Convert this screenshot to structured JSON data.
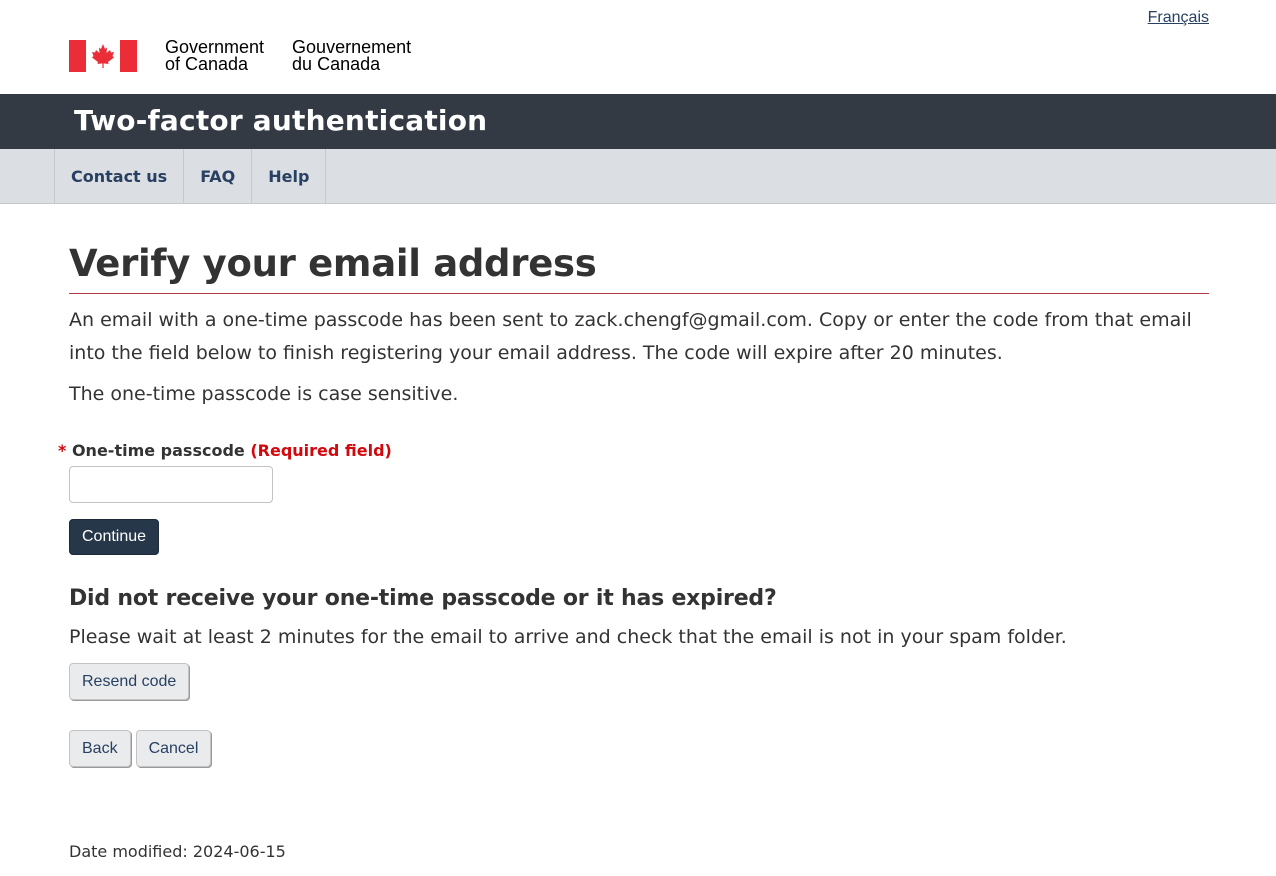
{
  "header": {
    "language_link": "Français",
    "wordmark": {
      "en_line1": "Government",
      "en_line2": "of Canada",
      "fr_line1": "Gouvernement",
      "fr_line2": "du Canada"
    },
    "site_title": "Two-factor authentication",
    "nav": [
      {
        "label": "Contact us"
      },
      {
        "label": "FAQ"
      },
      {
        "label": "Help"
      }
    ]
  },
  "main": {
    "title": "Verify your email address",
    "lead": "An email with a one-time passcode has been sent to zack.chengf@gmail.com. Copy or enter the code from that email into the field below to finish registering your email address. The code will expire after 20 minutes.",
    "case_note": "The one-time passcode is case sensitive.",
    "field": {
      "asterisk": "*",
      "label": "One-time passcode",
      "required": "(Required field)",
      "value": ""
    },
    "continue_label": "Continue",
    "resend_heading": "Did not receive your one-time passcode or it has expired?",
    "resend_text": "Please wait at least 2 minutes for the email to arrive and check that the email is not in your spam folder.",
    "resend_label": "Resend code",
    "back_label": "Back",
    "cancel_label": "Cancel"
  },
  "footer": {
    "date_modified_label": "Date modified:",
    "date_modified_value": "2024-06-15"
  },
  "colors": {
    "title_bar": "#333a44",
    "nav_bar": "#dbdee2",
    "primary_button": "#26374a",
    "flag_red": "#eb2d37",
    "required_red": "#d3080c"
  }
}
